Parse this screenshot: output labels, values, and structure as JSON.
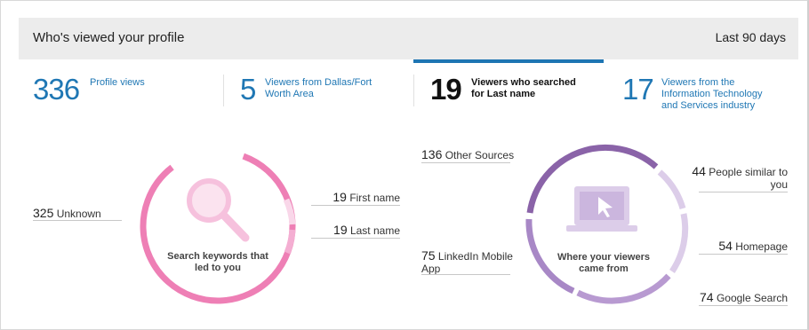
{
  "header": {
    "title": "Who's viewed your profile",
    "range": "Last 90 days"
  },
  "stats": [
    {
      "number": "336",
      "label": "Profile views"
    },
    {
      "number": "5",
      "label": "Viewers from Dallas/Fort Worth Area"
    },
    {
      "number": "19",
      "label": "Viewers who searched for Last name"
    },
    {
      "number": "17",
      "label": "Viewers from the Information Technology and Services industry"
    }
  ],
  "keywords": {
    "center_label": "Search keywords that led to you",
    "icon": "magnifier-icon",
    "items": [
      {
        "count": "325",
        "label": "Unknown"
      },
      {
        "count": "19",
        "label": "First name"
      },
      {
        "count": "19",
        "label": "Last name"
      }
    ]
  },
  "sources": {
    "center_label": "Where your viewers came from",
    "icon": "laptop-icon",
    "items": [
      {
        "count": "136",
        "label": "Other Sources"
      },
      {
        "count": "75",
        "label": "LinkedIn Mobile App"
      },
      {
        "count": "44",
        "label": "People similar to you"
      },
      {
        "count": "54",
        "label": "Homepage"
      },
      {
        "count": "74",
        "label": "Google Search"
      }
    ]
  },
  "colors": {
    "blue": "#1f77b4",
    "pink_main": "#ee7fb5",
    "pink_light": "#f6c1dd",
    "purple_dark": "#8a63a8",
    "purple_mid": "#a888c6",
    "purple_light": "#dccde9"
  }
}
